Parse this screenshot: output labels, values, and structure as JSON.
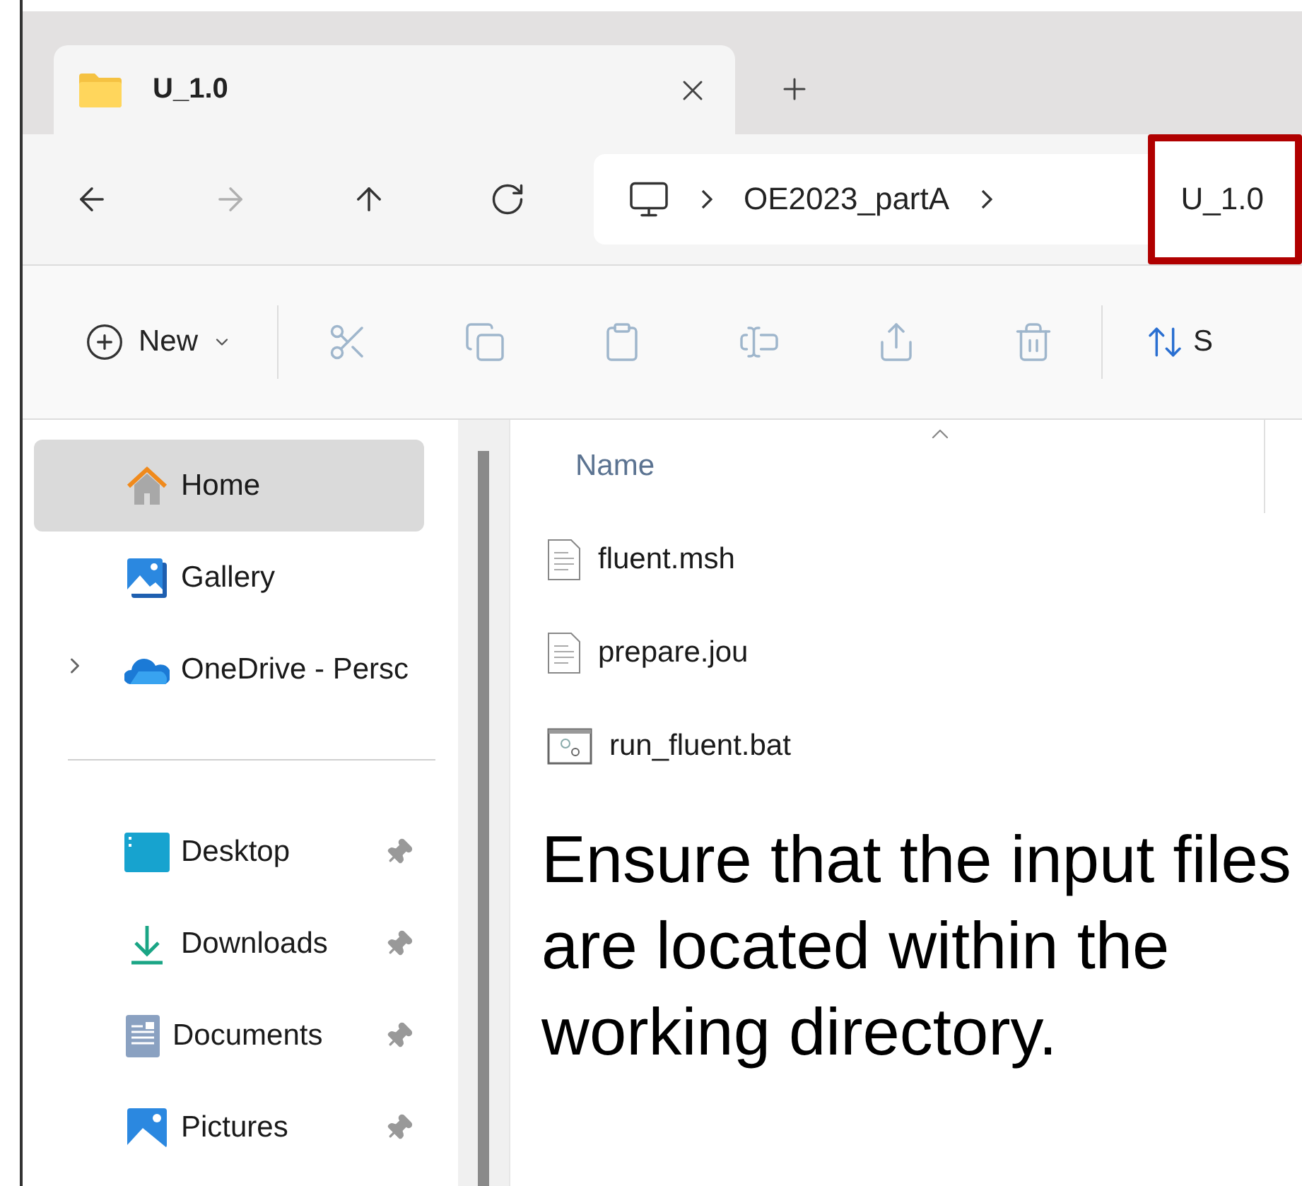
{
  "tabs": [
    {
      "label": "U_1.0",
      "selected": true
    }
  ],
  "nav": [
    {
      "kind": "back",
      "disabled": false
    },
    {
      "kind": "forward",
      "disabled": true
    },
    {
      "kind": "up",
      "disabled": false
    },
    {
      "kind": "refresh",
      "disabled": false
    }
  ],
  "breadcrumbs": [
    {
      "label": "OE2023_partA",
      "highlighted": false
    },
    {
      "label": "U_1.0",
      "highlighted": true
    }
  ],
  "toolbar": {
    "new_button": "New",
    "actions": [
      {
        "kind": "cut",
        "disabled": true
      },
      {
        "kind": "copy",
        "disabled": true
      },
      {
        "kind": "paste",
        "disabled": true
      },
      {
        "kind": "rename",
        "disabled": true
      },
      {
        "kind": "share",
        "disabled": true
      },
      {
        "kind": "delete",
        "disabled": true
      }
    ],
    "sort_button": "S"
  },
  "sidebar": {
    "items": [
      {
        "kind": "home",
        "label": "Home",
        "selected": true
      },
      {
        "kind": "gallery",
        "label": "Gallery",
        "selected": false
      },
      {
        "kind": "onedrive",
        "label": "OneDrive - Persc",
        "selected": false,
        "expanded": false
      }
    ],
    "pinned": [
      {
        "kind": "desktop",
        "label": "Desktop",
        "selected": false
      },
      {
        "kind": "downloads",
        "label": "Downloads",
        "selected": false
      },
      {
        "kind": "documents",
        "label": "Documents",
        "selected": false
      },
      {
        "kind": "pictures",
        "label": "Pictures",
        "selected": false
      }
    ]
  },
  "table": {
    "columns": [
      "Name"
    ],
    "rows": [
      {
        "name": "fluent.msh",
        "kind": "document"
      },
      {
        "name": "prepare.jou",
        "kind": "document"
      },
      {
        "name": "run_fluent.bat",
        "kind": "batch"
      }
    ]
  },
  "note": "Ensure that the input files are located within the working directory."
}
